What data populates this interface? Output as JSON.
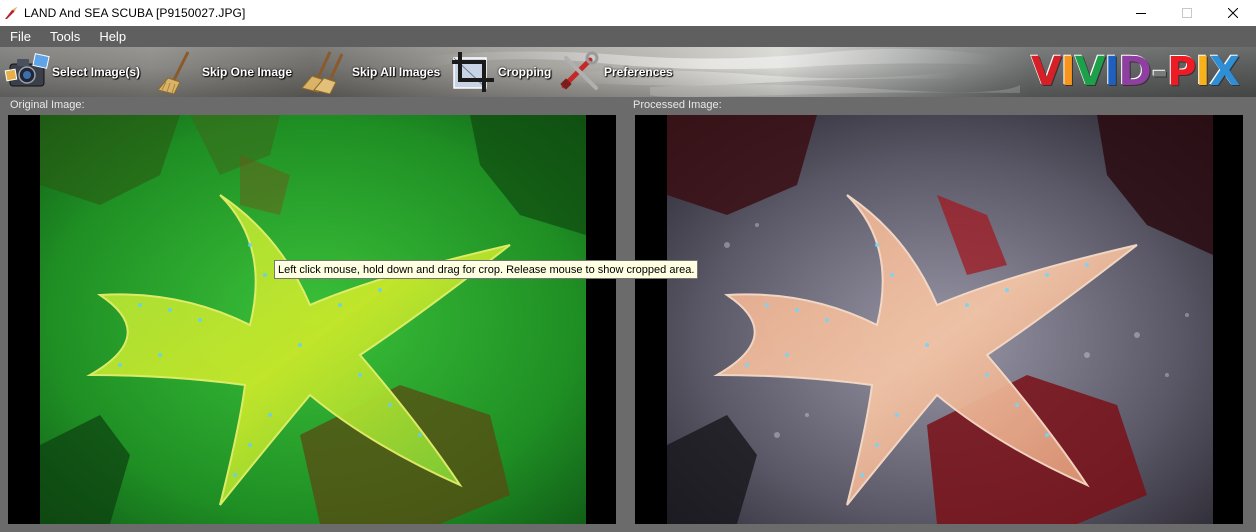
{
  "window": {
    "title": "LAND And SEA SCUBA  [P9150027.JPG]",
    "controls": {
      "minimize": "minimize-icon",
      "maximize": "maximize-icon",
      "close": "close-icon"
    }
  },
  "menu": {
    "items": [
      {
        "label": "File"
      },
      {
        "label": "Tools"
      },
      {
        "label": "Help"
      }
    ]
  },
  "toolbar": {
    "select_images": "Select Image(s)",
    "skip_one": "Skip One Image",
    "skip_all": "Skip All Images",
    "cropping": "Cropping",
    "preferences": "Preferences",
    "icons": [
      "camera-icon",
      "broom-icon",
      "double-broom-icon",
      "crop-icon",
      "tools-icon"
    ]
  },
  "logo": {
    "letters": [
      "V",
      "I",
      "V",
      "I",
      "D",
      "-",
      "P",
      "I",
      "X"
    ],
    "colors": [
      "#d62027",
      "#f7941d",
      "#1ca04a",
      "#1f5fbf",
      "#8e3fa0",
      "#7a7a7a",
      "#ed1c24",
      "#f6b21a",
      "#2f8fd6"
    ]
  },
  "panels": {
    "original_label": "Original Image:",
    "processed_label": "Processed Image:"
  },
  "tooltip": {
    "text": "Left click mouse, hold down and drag for crop.  Release mouse to show cropped area."
  },
  "colors": {
    "titlebar": "#ffffff",
    "menubar": "#5f5f5f",
    "background": "#6b6b6b",
    "tooltip_bg": "#ffffe1"
  }
}
